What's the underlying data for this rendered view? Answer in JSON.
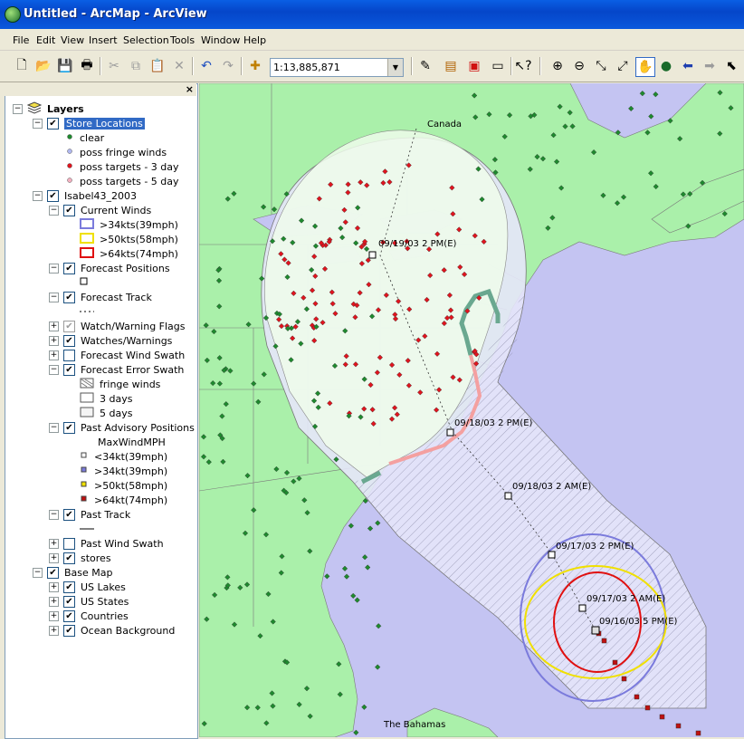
{
  "window": {
    "title": "Untitled - ArcMap - ArcView"
  },
  "menu": [
    "File",
    "Edit",
    "View",
    "Insert",
    "Selection",
    "Tools",
    "Window",
    "Help"
  ],
  "toolbar": {
    "scale": "1:13,885,871"
  },
  "toc": {
    "root": "Layers",
    "store_locations": {
      "name": "Store Locations",
      "classes": [
        "clear",
        "poss fringe winds",
        "poss targets - 3 day",
        "poss targets - 5 day"
      ]
    },
    "isabel": {
      "name": "Isabel43_2003",
      "current_winds": {
        "name": "Current Winds",
        "classes": [
          ">34kts(39mph)",
          ">50kts(58mph)",
          ">64kts(74mph)"
        ]
      },
      "forecast_positions": "Forecast Positions",
      "forecast_track": "Forecast Track",
      "watch_warning_flags": "Watch/Warning Flags",
      "watches_warnings": "Watches/Warnings",
      "forecast_wind_swath": "Forecast Wind Swath",
      "forecast_error_swath": {
        "name": "Forecast Error Swath",
        "classes": [
          "fringe winds",
          "3 days",
          "5 days"
        ]
      },
      "past_advisory": {
        "name": "Past Advisory Positions",
        "field": "MaxWindMPH",
        "classes": [
          "<34kt(39mph)",
          ">34kt(39mph)",
          ">50kt(58mph)",
          ">64kt(74mph)"
        ]
      },
      "past_track": "Past Track",
      "past_wind_swath": "Past Wind Swath",
      "stores": "stores"
    },
    "base_map": {
      "name": "Base Map",
      "layers": [
        "US Lakes",
        "US States",
        "Countries",
        "Ocean Background"
      ]
    }
  },
  "map": {
    "labels": {
      "canada": "Canada",
      "bahamas": "The Bahamas"
    },
    "positions": [
      "09/19/03 2 PM(E)",
      "09/18/03 2 PM(E)",
      "09/18/03 2 AM(E)",
      "09/17/03 2 PM(E)",
      "09/17/03 2 AM(E)",
      "09/16/03 5 PM(E)"
    ],
    "colors": {
      "ocean": "#c4c4f2",
      "land": "#aaf0aa",
      "error_swath": "#e6e6fa",
      "fringe": "#eefceb",
      "store_clear": "#1e8a2e",
      "store_target": "#e0141e",
      "wind34": "#7b7bdc",
      "wind50": "#f0f000",
      "wind64": "#e01010"
    }
  }
}
